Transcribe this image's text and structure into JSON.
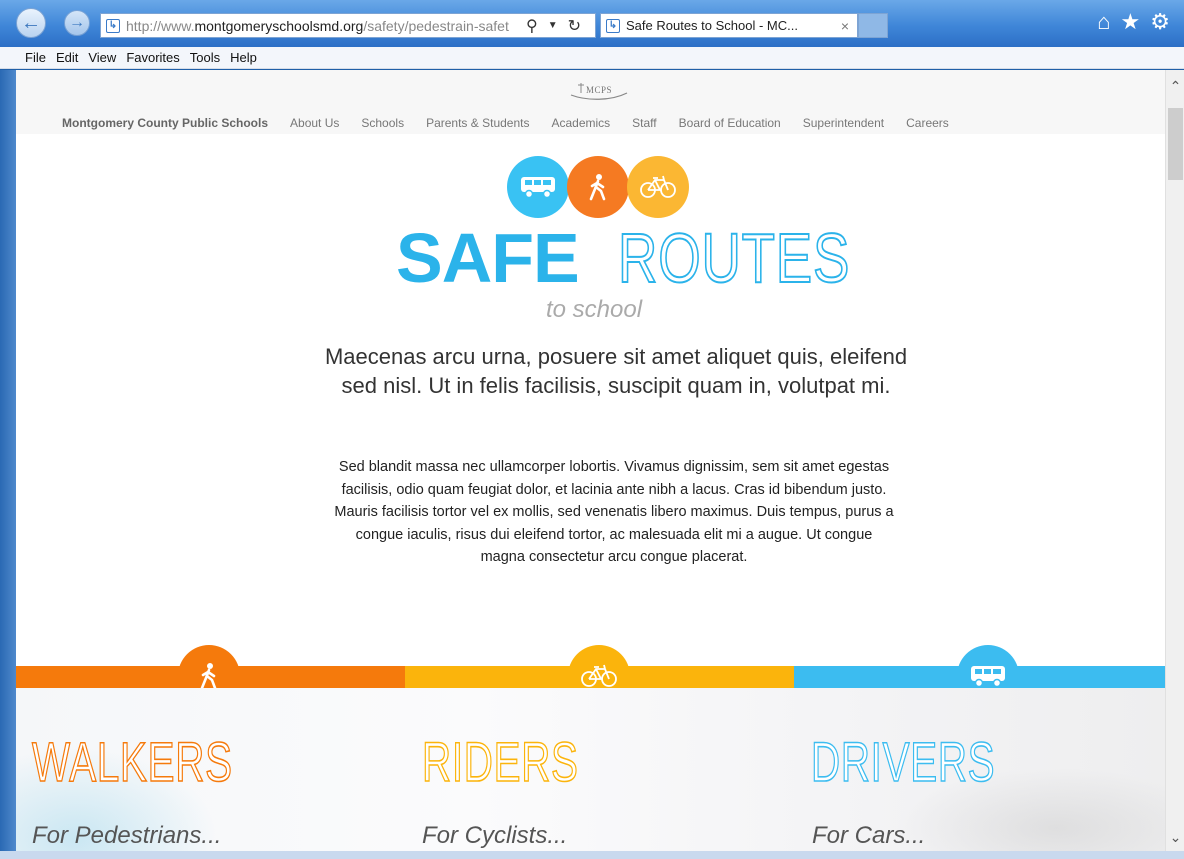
{
  "browser": {
    "url_prefix": "http://www.",
    "url_domain": "montgomeryschoolsmd.org",
    "url_path": "/safety/pedestrain-safet",
    "tab_title": "Safe Routes to School - MC...",
    "tab_close": "×",
    "menu": [
      "File",
      "Edit",
      "View",
      "Favorites",
      "Tools",
      "Help"
    ],
    "icons": [
      "back-icon",
      "forward-icon",
      "search-icon",
      "refresh-icon",
      "home-icon",
      "favorites-star-icon",
      "settings-gear-icon"
    ]
  },
  "site": {
    "logo_text": "MCPS",
    "nav": [
      "Montgomery County Public Schools",
      "About Us",
      "Schools",
      "Parents & Students",
      "Academics",
      "Staff",
      "Board of Education",
      "Superintendent",
      "Careers"
    ]
  },
  "hero": {
    "title_bold": "SAFE",
    "title_outline": "ROUTES",
    "subtitle": "to school",
    "lede": "Maecenas arcu urna, posuere sit amet aliquet quis, eleifend sed nisl. Ut in felis facilisis, suscipit quam in, volutpat mi.",
    "body": "Sed blandit massa nec ullamcorper lobortis. Vivamus dignissim, sem sit amet egestas facilisis, odio quam feugiat dolor, et lacinia ante nibh a lacus. Cras id bibendum justo. Mauris facilisis tortor vel ex mollis, sed venenatis libero maximus. Duis tempus, purus a congue iaculis, risus dui eleifend tortor, ac malesuada elit mi a augue. Ut congue magna consectetur arcu congue placerat."
  },
  "sections": {
    "walkers": {
      "title": "WALKERS",
      "subtitle": "For Pedestrians..."
    },
    "riders": {
      "title": "RIDERS",
      "subtitle": "For Cyclists..."
    },
    "drivers": {
      "title": "DRIVERS",
      "subtitle": "For Cars..."
    }
  },
  "colors": {
    "walk": "#f57a0c",
    "ride": "#fbb40c",
    "drive": "#3cbcf0",
    "title_blue": "#2bb3ea"
  }
}
